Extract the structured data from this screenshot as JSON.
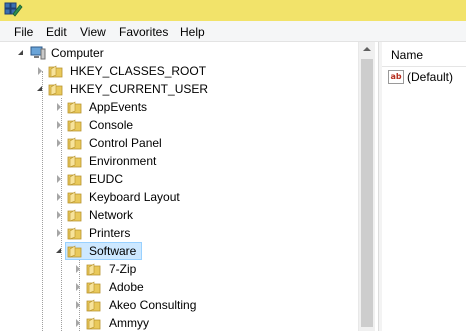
{
  "window": {
    "title_bar_color": "#f2e36a",
    "app_icon": "regedit-icon"
  },
  "menu": {
    "file": "File",
    "edit": "Edit",
    "view": "View",
    "favorites": "Favorites",
    "help": "Help"
  },
  "tree": {
    "root": "Computer",
    "hkcr": "HKEY_CLASSES_ROOT",
    "hkcu": "HKEY_CURRENT_USER",
    "children": [
      "AppEvents",
      "Console",
      "Control Panel",
      "Environment",
      "EUDC",
      "Keyboard Layout",
      "Network",
      "Printers",
      "Software"
    ],
    "software_children": [
      "7-Zip",
      "Adobe",
      "Akeo Consulting",
      "Ammyy"
    ],
    "selected": "Software"
  },
  "list": {
    "header_name": "Name",
    "values": [
      {
        "name": "(Default)",
        "type_icon": "string-value-icon"
      }
    ]
  },
  "colors": {
    "selection": "#cde8ff",
    "folder": "#e9c95b"
  }
}
